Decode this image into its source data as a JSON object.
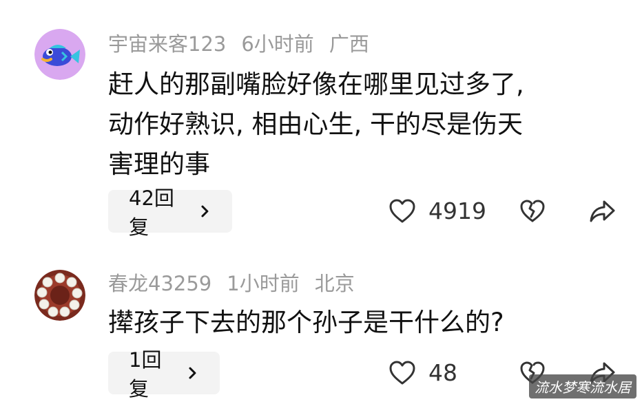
{
  "comments": [
    {
      "username": "宇宙来客123",
      "time": "6小时前",
      "location": "广西",
      "text_lines": [
        "赶人的那副嘴脸好像在哪里见过多了,",
        "动作好熟识, 相由心生, 干的尽是伤天",
        "害理的事"
      ],
      "reply_label": "42回复",
      "likes": "4919",
      "avatar_icon": "cartoon-fish-avatar"
    },
    {
      "username": "春龙43259",
      "time": "1小时前",
      "location": "北京",
      "text_lines": [
        "撵孩子下去的那个孙子是干什么的?"
      ],
      "reply_label": "1回复",
      "likes": "48",
      "avatar_icon": "bead-bracelet-avatar"
    }
  ],
  "icons": {
    "like": "heart-outline-icon",
    "dislike": "broken-heart-icon",
    "share": "share-arrow-icon",
    "reply_chevron": "chevron-right-icon"
  },
  "colors": {
    "meta_text": "#9a9a9a",
    "content_text": "#111111",
    "reply_bg": "#f3f3f3",
    "icon_stroke": "#333333",
    "avatar_1_bg": "#d9a8f0"
  },
  "watermark": "流水梦寒流水居"
}
